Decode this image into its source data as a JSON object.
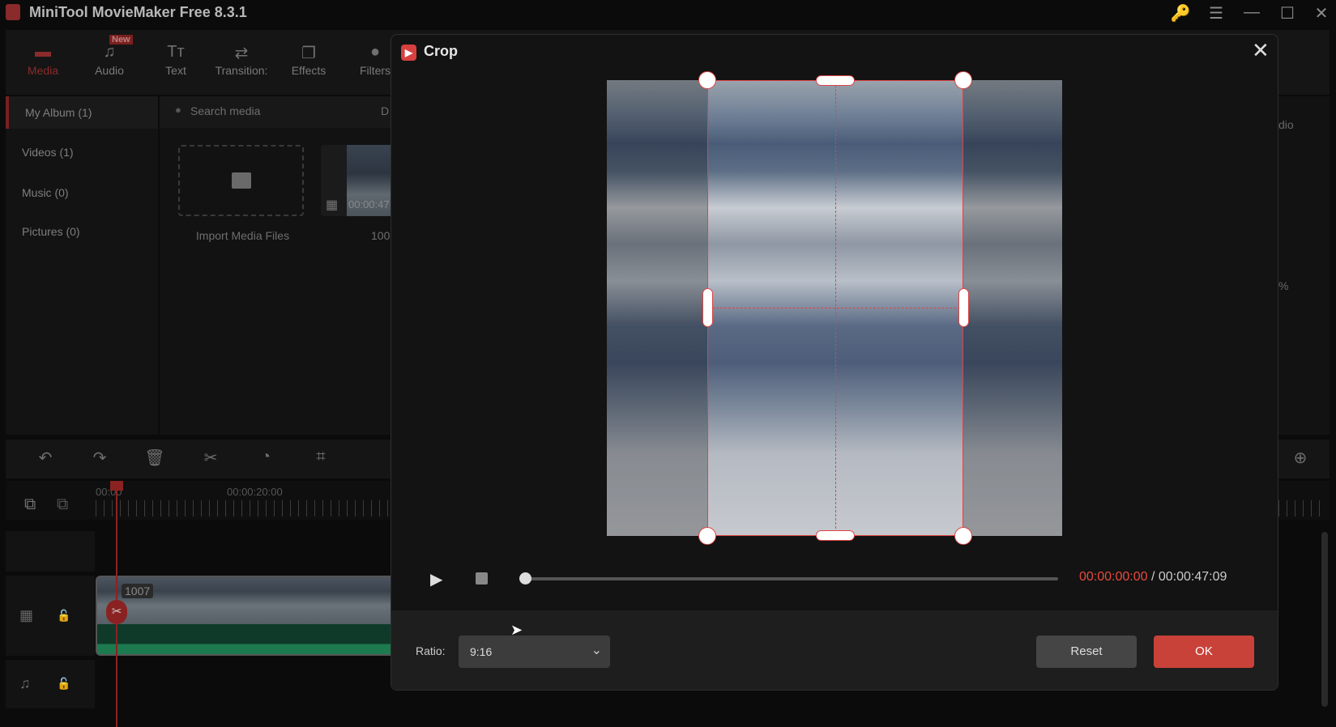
{
  "app": {
    "title": "MiniTool MovieMaker Free 8.3.1"
  },
  "window_controls": {
    "key": "🔑",
    "menu": "☰",
    "minimize": "—",
    "maximize": "☐",
    "close": "✕"
  },
  "toolbar": {
    "tabs": [
      {
        "label": "Media",
        "icon": "▬"
      },
      {
        "label": "Audio",
        "icon": "♫"
      },
      {
        "label": "Text",
        "icon": "Tт"
      },
      {
        "label": "Transition:",
        "icon": "⇄"
      },
      {
        "label": "Effects",
        "icon": "❐"
      },
      {
        "label": "Filters",
        "icon": "●"
      }
    ],
    "new_badge": "New"
  },
  "album": {
    "items": [
      "My Album (1)",
      "Videos (1)",
      "Music (0)",
      "Pictures (0)"
    ]
  },
  "media": {
    "search_placeholder": "Search media",
    "download_partial": "D",
    "import_label": "Import Media Files",
    "thumb_duration": "00:00:47",
    "thumb_name": "100"
  },
  "right_panel": {
    "partial_button": "dio",
    "partial_percent": "%"
  },
  "timeline": {
    "ruler_labels": [
      "00:00",
      "00:00:20:00"
    ],
    "clip_name": "1007"
  },
  "dialog": {
    "title": "Crop",
    "logo": "▶",
    "current_time": "00:00:00:00",
    "separator": " / ",
    "total_time": "00:00:47:09",
    "progress": 0,
    "ratio_label": "Ratio:",
    "ratio_value": "9:16",
    "reset_label": "Reset",
    "ok_label": "OK"
  },
  "colors": {
    "accent": "#d84040",
    "time_current": "#e84a3e"
  }
}
